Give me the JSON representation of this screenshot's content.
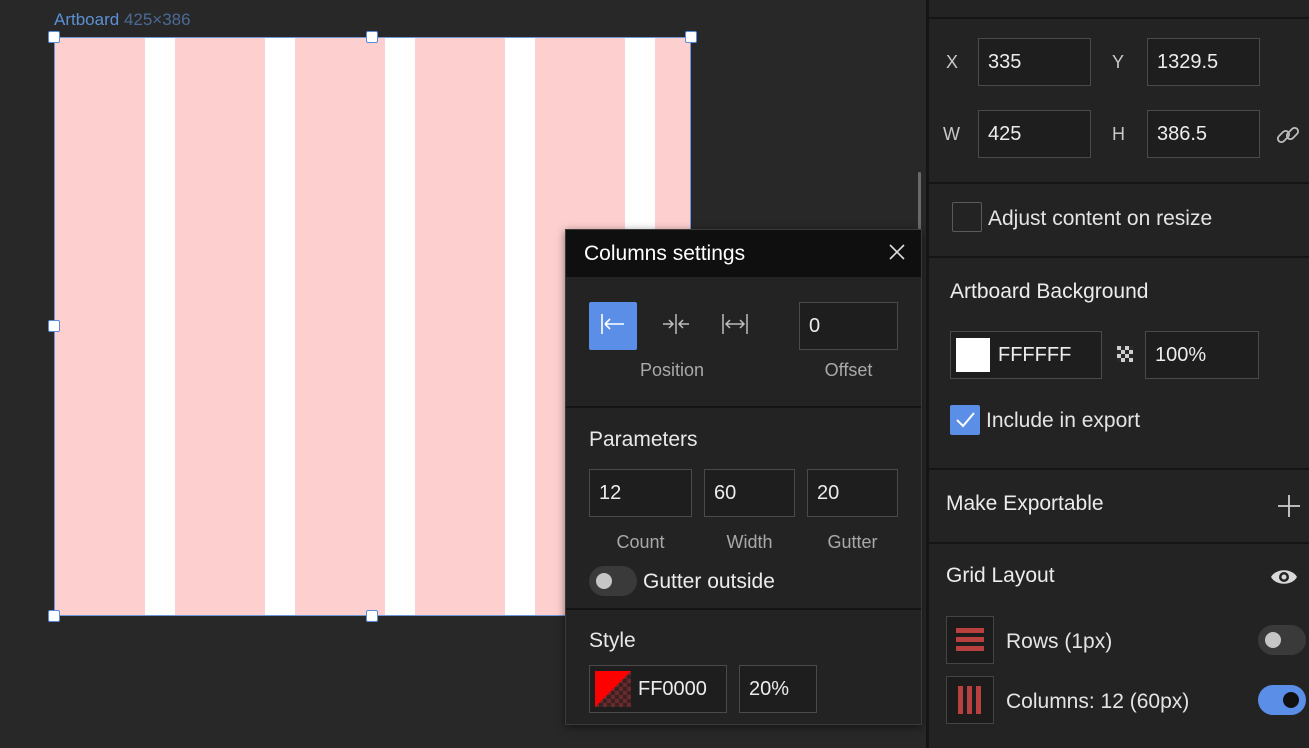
{
  "artboard": {
    "name": "Artboard",
    "dims": "425×386"
  },
  "columns_popup": {
    "title": "Columns settings",
    "position_caption": "Position",
    "offset_caption": "Offset",
    "offset_value": "0",
    "parameters_title": "Parameters",
    "count_value": "12",
    "width_value": "60",
    "gutter_value": "20",
    "count_caption": "Count",
    "width_caption": "Width",
    "gutter_caption": "Gutter",
    "gutter_outside_label": "Gutter outside",
    "gutter_outside_on": false,
    "style_title": "Style",
    "color_hex": "FF0000",
    "opacity": "20%",
    "icons": [
      "align-left-icon",
      "align-center-icon",
      "align-stretch-icon",
      "close-icon"
    ]
  },
  "right_panel": {
    "x_label": "X",
    "x_value": "335",
    "y_label": "Y",
    "y_value": "1329.5",
    "w_label": "W",
    "w_value": "425",
    "h_label": "H",
    "h_value": "386.5",
    "adjust_content_label": "Adjust content on resize",
    "adjust_content_checked": false,
    "background_title": "Artboard Background",
    "background_hex": "FFFFFF",
    "background_opacity": "100%",
    "include_export_label": "Include in export",
    "include_export_checked": true,
    "make_exportable_title": "Make Exportable",
    "grid_layout_title": "Grid Layout",
    "rows_label": "Rows (1px)",
    "rows_on": false,
    "columns_label": "Columns: 12 (60px)",
    "columns_on": true,
    "icons": [
      "link-icon",
      "checker-icon",
      "plus-icon",
      "eye-icon",
      "rows-icon",
      "columns-icon",
      "checkmark-icon"
    ]
  },
  "colors": {
    "accent": "#5b8ee6",
    "artboard_fill": "#fecfcf",
    "grid_red": "#b8403f",
    "background": "#282828",
    "panel": "#232323"
  }
}
